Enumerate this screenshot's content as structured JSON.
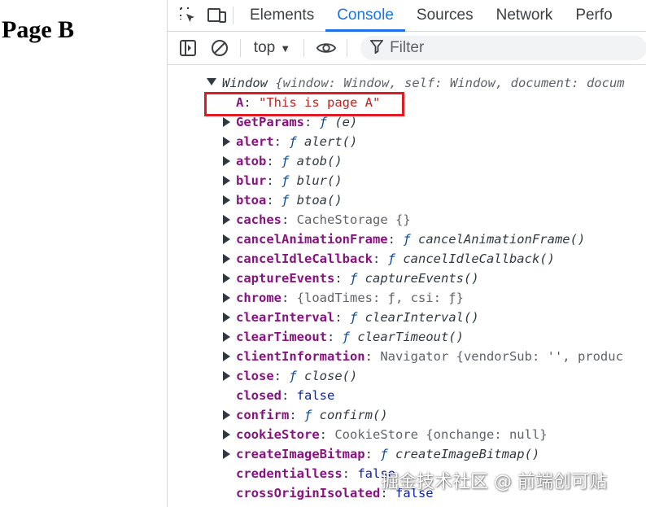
{
  "page": {
    "title": "Page B"
  },
  "tabs": [
    {
      "label": "Elements"
    },
    {
      "label": "Console"
    },
    {
      "label": "Sources"
    },
    {
      "label": "Network"
    },
    {
      "label": "Perfo"
    }
  ],
  "toolbar": {
    "context": "top",
    "filter_placeholder": "Filter"
  },
  "console": {
    "root": {
      "label": "Window",
      "preview": "{window: Window, self: Window, document: docum"
    },
    "properties": [
      {
        "key": "A",
        "value": "\"This is page A\"",
        "kind": "string",
        "expandable": false,
        "highlighted": true
      },
      {
        "key": "GetParams",
        "value": "(e)",
        "kind": "function",
        "expandable": true
      },
      {
        "key": "alert",
        "value": "alert()",
        "kind": "function",
        "expandable": true
      },
      {
        "key": "atob",
        "value": "atob()",
        "kind": "function",
        "expandable": true
      },
      {
        "key": "blur",
        "value": "blur()",
        "kind": "function",
        "expandable": true
      },
      {
        "key": "btoa",
        "value": "btoa()",
        "kind": "function",
        "expandable": true
      },
      {
        "key": "caches",
        "value": "CacheStorage {}",
        "kind": "object",
        "expandable": true
      },
      {
        "key": "cancelAnimationFrame",
        "value": "cancelAnimationFrame()",
        "kind": "function",
        "expandable": true
      },
      {
        "key": "cancelIdleCallback",
        "value": "cancelIdleCallback()",
        "kind": "function",
        "expandable": true
      },
      {
        "key": "captureEvents",
        "value": "captureEvents()",
        "kind": "function",
        "expandable": true
      },
      {
        "key": "chrome",
        "value": "{loadTimes: ƒ, csi: ƒ}",
        "kind": "object",
        "expandable": true
      },
      {
        "key": "clearInterval",
        "value": "clearInterval()",
        "kind": "function",
        "expandable": true
      },
      {
        "key": "clearTimeout",
        "value": "clearTimeout()",
        "kind": "function",
        "expandable": true
      },
      {
        "key": "clientInformation",
        "value": "Navigator {vendorSub: '', produc",
        "kind": "object",
        "expandable": true
      },
      {
        "key": "close",
        "value": "close()",
        "kind": "function",
        "expandable": true
      },
      {
        "key": "closed",
        "value": "false",
        "kind": "boolean",
        "expandable": false
      },
      {
        "key": "confirm",
        "value": "confirm()",
        "kind": "function",
        "expandable": true
      },
      {
        "key": "cookieStore",
        "value": "CookieStore {onchange: null}",
        "kind": "object",
        "expandable": true
      },
      {
        "key": "createImageBitmap",
        "value": "createImageBitmap()",
        "kind": "function",
        "expandable": true
      },
      {
        "key": "credentialless",
        "value": "false",
        "kind": "boolean",
        "expandable": false
      },
      {
        "key": "crossOriginIsolated",
        "value": "false",
        "kind": "boolean",
        "expandable": false
      }
    ]
  },
  "watermark": "掘金技术社区 @ 前端创可贴",
  "colors": {
    "accent": "#1a73e8",
    "highlight_box": "#e01b24",
    "key": "#881280",
    "string": "#c5221f",
    "keyword": "#0d22aa"
  }
}
